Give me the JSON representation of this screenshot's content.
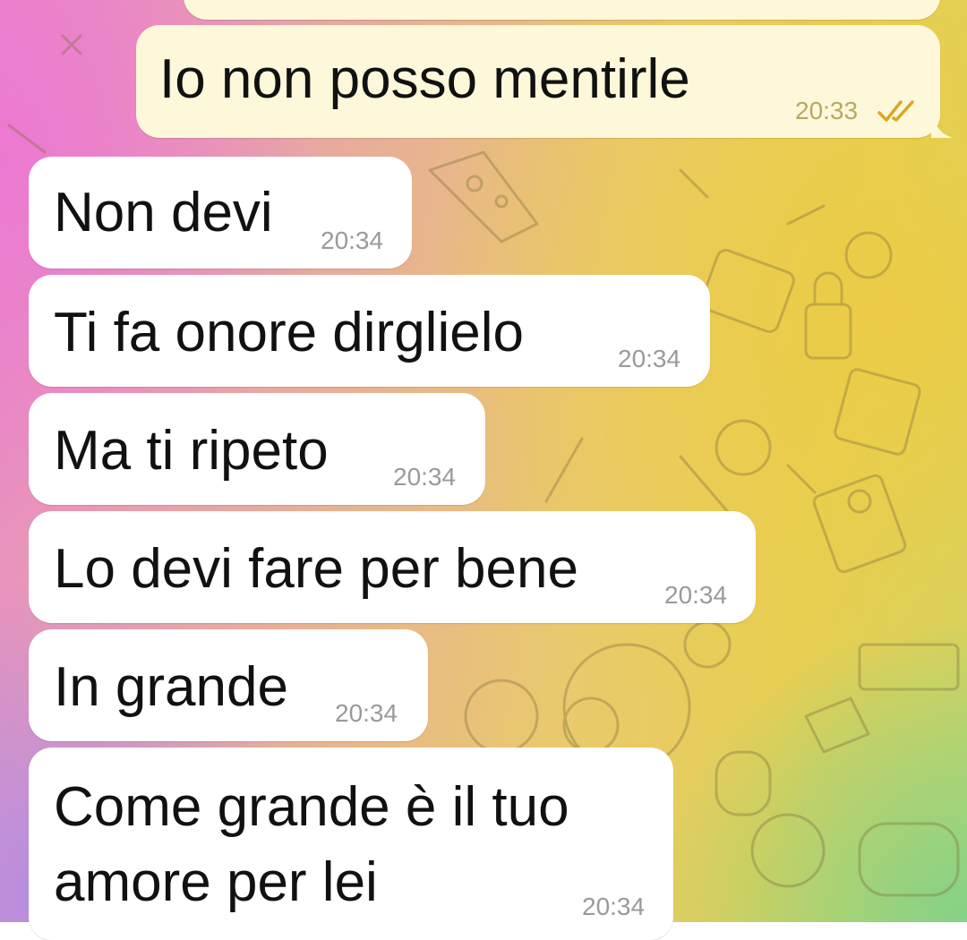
{
  "messages": [
    {
      "direction": "out",
      "text": "Io non posso mentirle",
      "time": "20:33",
      "status_icon": "double-check-icon"
    },
    {
      "direction": "in",
      "text": "Non devi",
      "time": "20:34"
    },
    {
      "direction": "in",
      "text": "Ti fa onore dirglielo",
      "time": "20:34"
    },
    {
      "direction": "in",
      "text": "Ma ti ripeto",
      "time": "20:34"
    },
    {
      "direction": "in",
      "text": "Lo devi fare per bene",
      "time": "20:34"
    },
    {
      "direction": "in",
      "text": "In grande",
      "time": "20:34"
    },
    {
      "direction": "in",
      "text_line1": "Come grande è il tuo",
      "text_line2": "amore per lei",
      "time": "20:34"
    }
  ],
  "colors": {
    "incoming_bubble": "#ffffff",
    "outgoing_bubble": "#fcf8d9",
    "read_check": "#d9a728"
  }
}
